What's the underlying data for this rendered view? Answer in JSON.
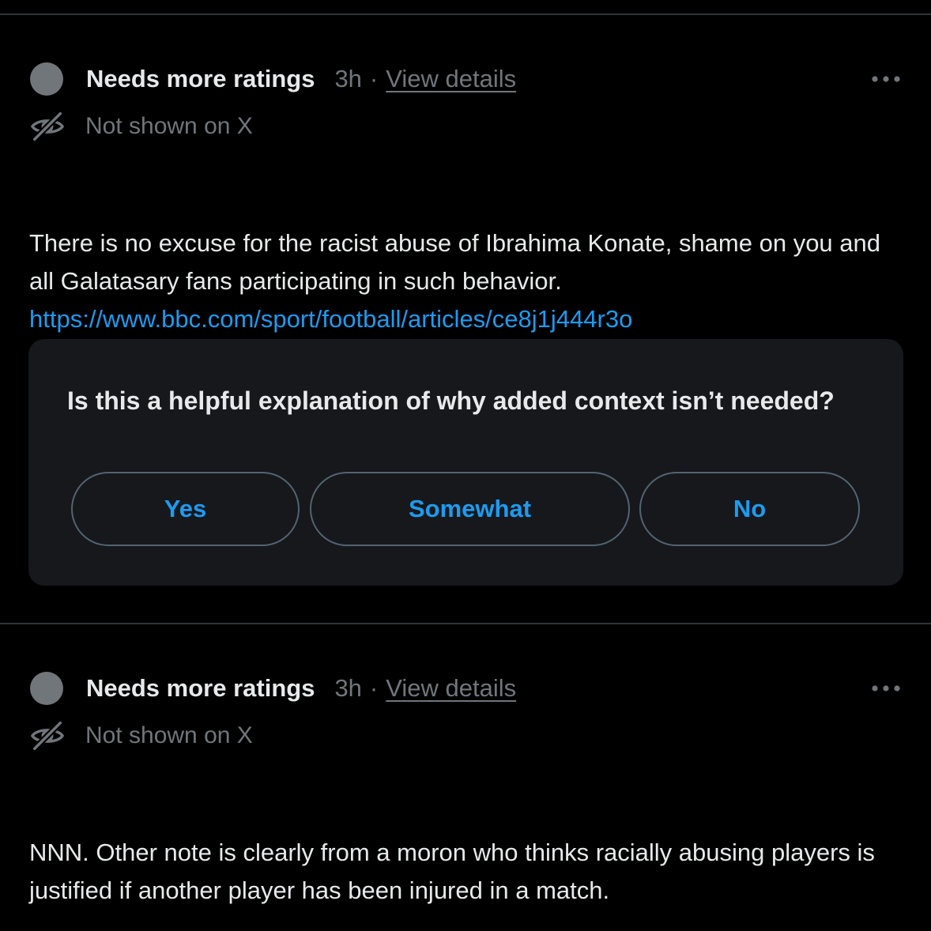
{
  "notes": [
    {
      "status": "Needs more ratings",
      "time": "3h",
      "separator": "·",
      "view_details": "View details",
      "visibility": "Not shown on X",
      "text": "There is no excuse for the racist abuse of Ibrahima Konate, shame on you and all Galatasary fans participating in such behavior.",
      "link": "https://www.bbc.com/sport/football/articles/ce8j1j444r3o",
      "icons": {
        "more": "more-horizontal-icon",
        "visibility": "eye-off-icon"
      }
    },
    {
      "status": "Needs more ratings",
      "time": "3h",
      "separator": "·",
      "view_details": "View details",
      "visibility": "Not shown on X",
      "text": "NNN. Other note is clearly from a moron who thinks racially abusing players is justified if another player has been injured in a match.",
      "icons": {
        "more": "more-horizontal-icon",
        "visibility": "eye-off-icon"
      }
    }
  ],
  "rating": {
    "question": "Is this a helpful explanation of why added context isn’t needed?",
    "options": [
      "Yes",
      "Somewhat",
      "No"
    ]
  },
  "colors": {
    "background": "#000000",
    "text_primary": "#e7e9ea",
    "text_secondary": "#71767b",
    "link": "#1d9bf0",
    "card_background": "#16181c",
    "button_border": "#536471",
    "divider": "#2f3336"
  }
}
